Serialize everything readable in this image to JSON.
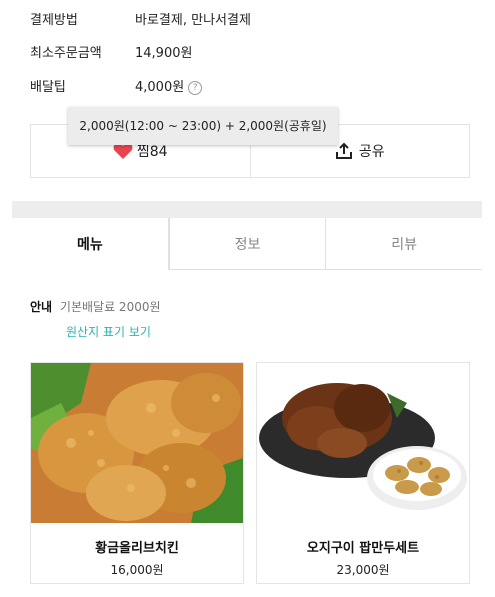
{
  "store_info": {
    "payment_label": "결제방법",
    "payment_value": "바로결제, 만나서결제",
    "min_order_label": "최소주문금액",
    "min_order_value": "14,900원",
    "delivery_tip_label": "배달팁",
    "delivery_tip_value": "4,000원",
    "delivery_tip_help": "?"
  },
  "tooltip": {
    "text": "2,000원(12:00 ~ 23:00) + 2,000원(공휴일)"
  },
  "actions": {
    "like_label": "찜84",
    "share_label": "공유"
  },
  "tabs": [
    {
      "label": "메뉴",
      "active": true
    },
    {
      "label": "정보",
      "active": false
    },
    {
      "label": "리뷰",
      "active": false
    }
  ],
  "notice": {
    "label": "안내",
    "text": "기본배달료 2000원",
    "origin_link": "원산지 표기 보기"
  },
  "menu": [
    {
      "name": "황금올리브치킨",
      "price": "16,000원"
    },
    {
      "name": "오지구이 팝만두세트",
      "price": "23,000원"
    }
  ],
  "colors": {
    "heart": "#e8434f",
    "link": "#2ab5b0",
    "divider": "#ededed"
  }
}
